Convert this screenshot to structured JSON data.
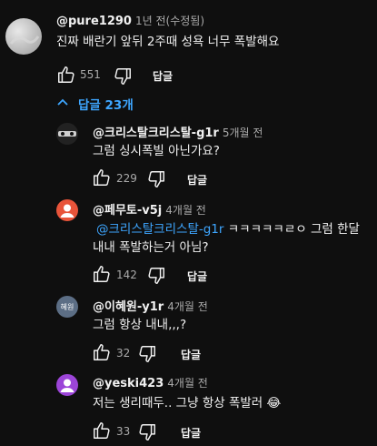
{
  "top_comment": {
    "author": "@pure1290",
    "time": "1년 전(수정됨)",
    "text": "진짜 배란기 앞뒤 2주때 성욕 너무 폭발해요",
    "likes": "551",
    "reply_label": "답글"
  },
  "replies_toggle": {
    "label": "답글 23개"
  },
  "replies": [
    {
      "author": "@크리스탈크리스탈-g1r",
      "time": "5개월 전",
      "line1": "그럼 싱시폭빌 아닌가요?",
      "likes": "229",
      "reply_label": "답글"
    },
    {
      "author": "@페무토-v5j",
      "time": "4개월 전",
      "mention": "@크리스탈크리스탈-g1r",
      "line1_rest": " ㅋㅋㅋㅋㅋㄹㅇ 그럼 한달",
      "line2": "내내 폭발하는거 아님?",
      "likes": "142",
      "reply_label": "답글"
    },
    {
      "author": "@이혜원-y1r",
      "time": "4개월 전",
      "avatar_text": "혜원",
      "line1": "그럼 항상 내내,,,?",
      "likes": "32",
      "reply_label": "답글"
    },
    {
      "author": "@yeski423",
      "time": "4개월 전",
      "line1": "저는 생리때두.. 그냥 항상 폭발러",
      "emoji": "😂",
      "likes": "33",
      "reply_label": "답글"
    }
  ],
  "colors": {
    "background": "#0f0f0f",
    "link": "#3ea6ff",
    "avatar_red": "#e8543a",
    "avatar_slate": "#5c6e85",
    "avatar_purple": "#9c45d8"
  }
}
